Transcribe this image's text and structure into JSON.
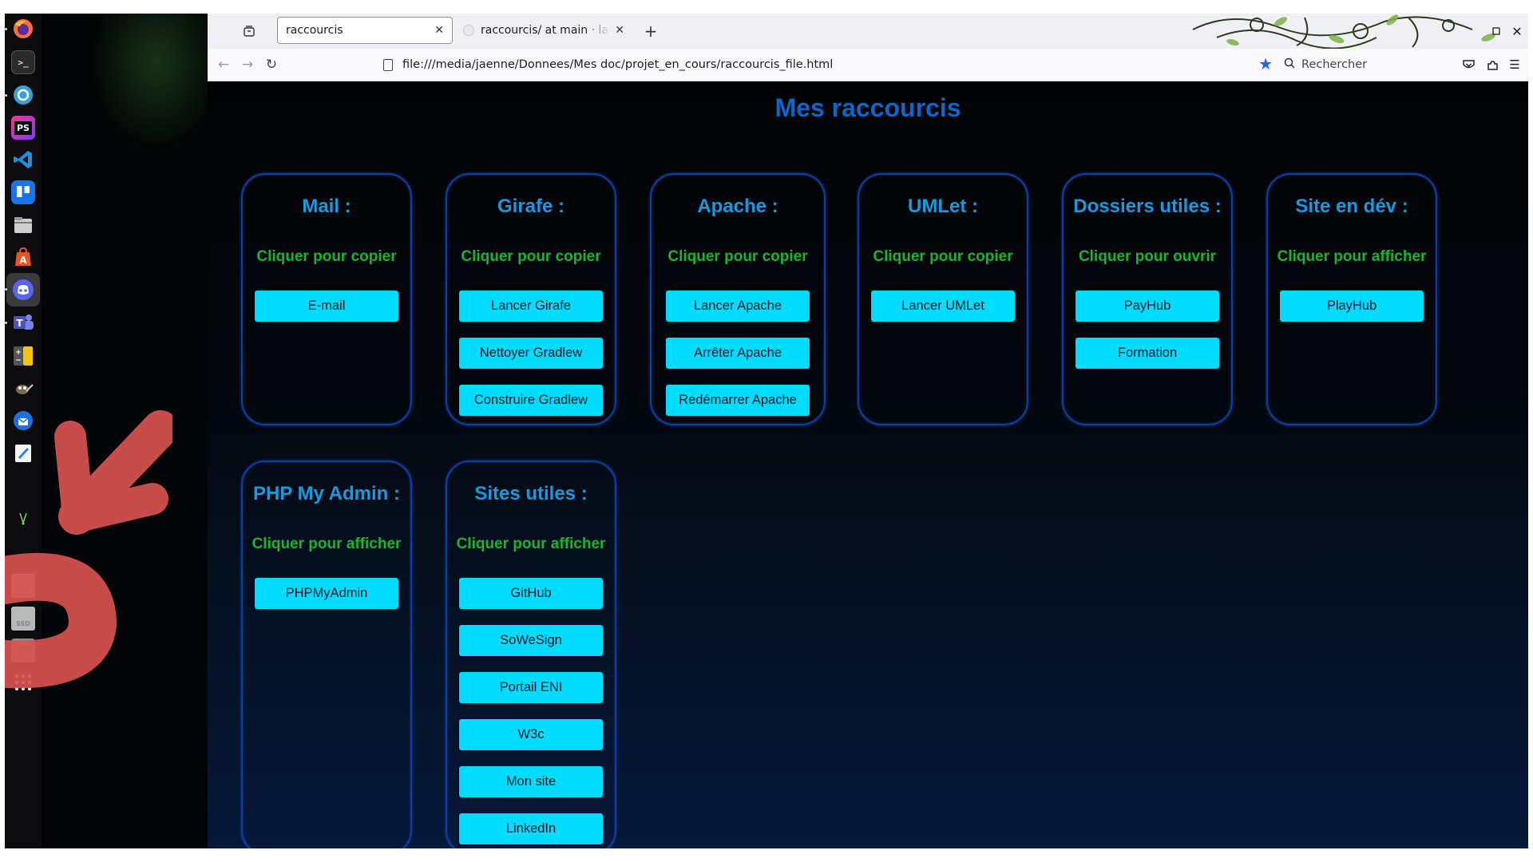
{
  "browser": {
    "tabs": [
      {
        "title": "raccourcis",
        "active": true
      },
      {
        "title": "raccourcis/ at main · lauri",
        "active": false
      }
    ],
    "new_tab_label": "+",
    "url": "file:///media/jaenne/Donnees/Mes doc/projet_en_cours/raccourcis_file.html",
    "search_placeholder": "Rechercher"
  },
  "page": {
    "title": "Mes raccourcis",
    "cards": [
      {
        "title": "Mail :",
        "subtitle": "Cliquer pour copier",
        "buttons": [
          "E-mail"
        ]
      },
      {
        "title": "Girafe :",
        "subtitle": "Cliquer pour copier",
        "buttons": [
          "Lancer Girafe",
          "Nettoyer Gradlew",
          "Construire Gradlew"
        ]
      },
      {
        "title": "Apache :",
        "subtitle": "Cliquer pour copier",
        "buttons": [
          "Lancer Apache",
          "Arrêter Apache",
          "Redémarrer Apache"
        ]
      },
      {
        "title": "UMLet :",
        "subtitle": "Cliquer pour copier",
        "buttons": [
          "Lancer UMLet"
        ]
      },
      {
        "title": "Dossiers utiles :",
        "subtitle": "Cliquer pour ouvrir",
        "buttons": [
          "PayHub",
          "Formation"
        ]
      },
      {
        "title": "Site en dév :",
        "subtitle": "Cliquer pour afficher",
        "buttons": [
          "PlayHub"
        ]
      },
      {
        "title": "PHP My Admin :",
        "subtitle": "Cliquer pour afficher",
        "buttons": [
          "PHPMyAdmin"
        ]
      },
      {
        "title": "Sites utiles :",
        "subtitle": "Cliquer pour afficher",
        "buttons": [
          "GitHub",
          "SoWeSign",
          "Portail ENI",
          "W3c",
          "Mon site",
          "LinkedIn"
        ]
      }
    ]
  },
  "dock": {
    "icons": [
      "firefox-icon",
      "terminal-icon",
      "settings-app-icon",
      "phpstorm-icon",
      "vscode-icon",
      "trello-icon",
      "files-icon",
      "app-center-icon",
      "discord-icon",
      "teams-icon",
      "calculator-icon",
      "gimp-icon",
      "thunderbird-icon",
      "text-editor-icon",
      "app-icon",
      "ssd-drive-icon",
      "ssd-drive-icon",
      "trash-icon",
      "show-apps-icon"
    ],
    "labels": {
      "phpstorm": "PS",
      "teams": "T",
      "ssd": "SSD"
    }
  },
  "colors": {
    "page_title": "#0b67c9",
    "card_border": "#0d3f9e",
    "card_title": "#169ae0",
    "card_subtitle": "#17b532",
    "button_bg": "#00dcff",
    "annotation_arrow": "#d9534f"
  }
}
